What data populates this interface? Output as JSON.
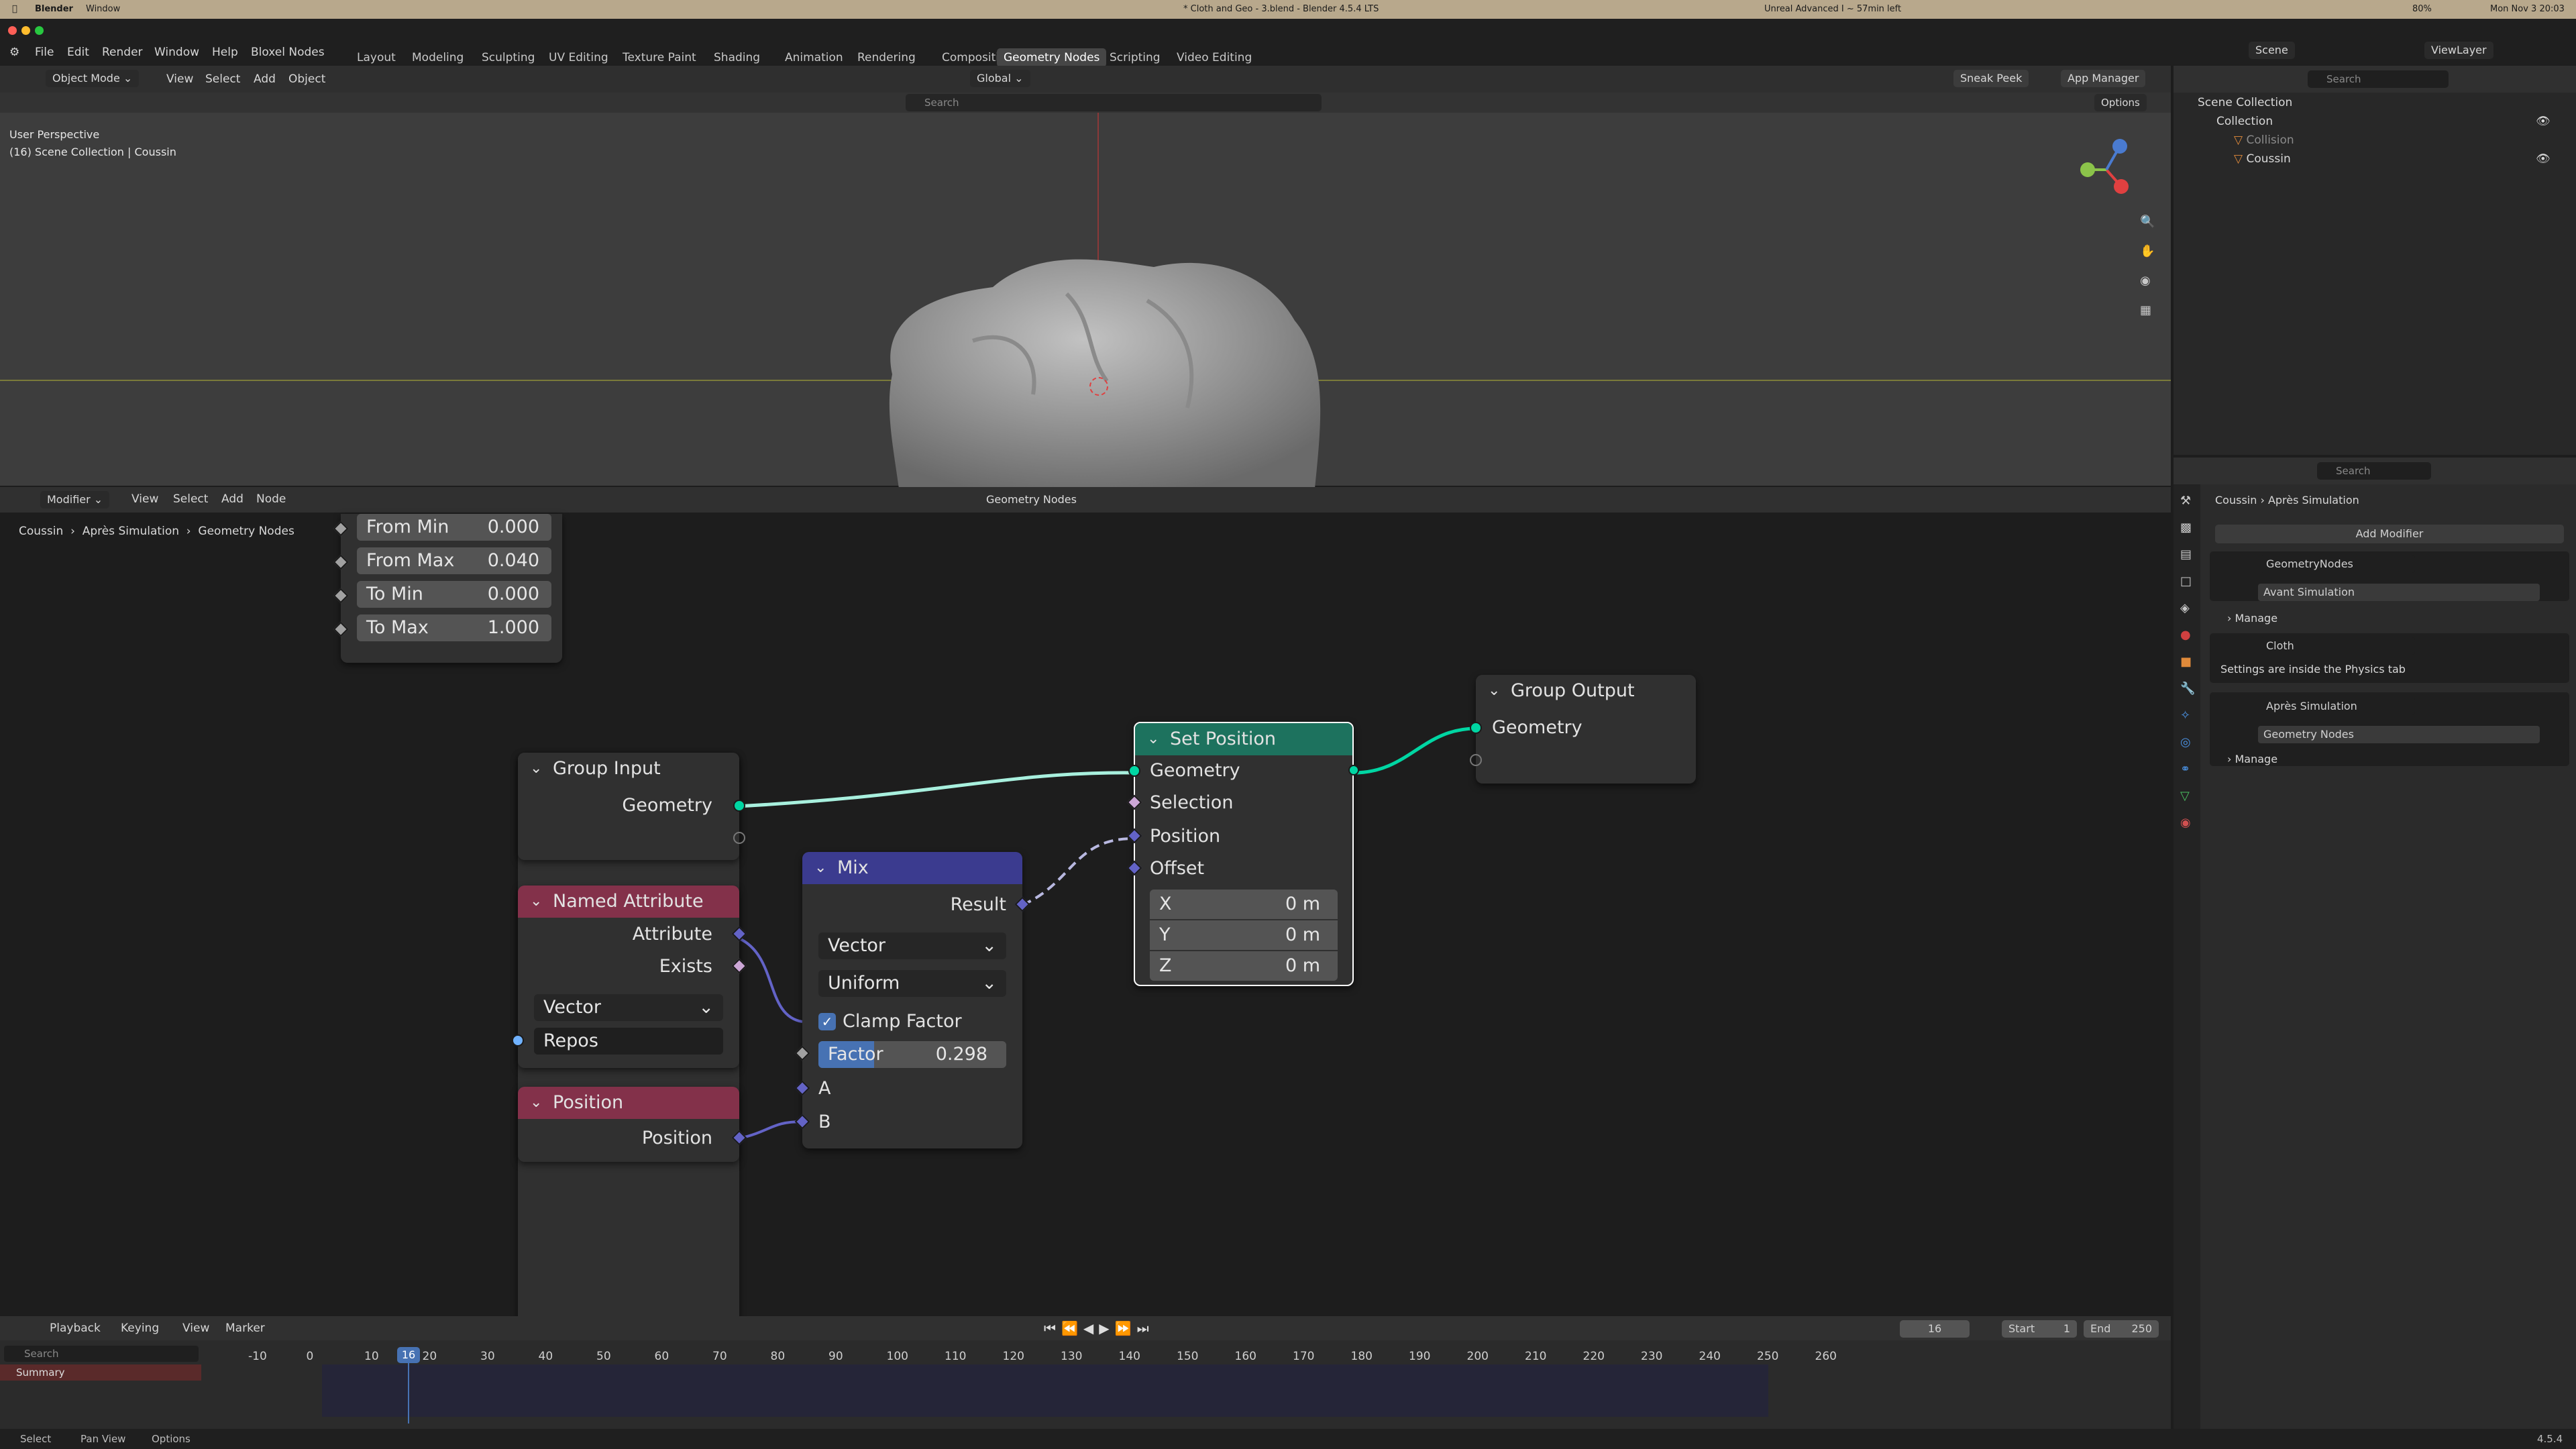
{
  "macbar": {
    "app": "Blender",
    "window": "Window",
    "doc_title": "* Cloth and Geo - 3.blend - Blender 4.5.4 LTS",
    "status": "Unreal Advanced I ~ 57min left",
    "battery": "80%",
    "datetime": "Mon Nov 3 20:03"
  },
  "menu": {
    "file": "File",
    "edit": "Edit",
    "render": "Render",
    "window": "Window",
    "help": "Help",
    "bloxel": "Bloxel Nodes"
  },
  "workspaces": [
    "Layout",
    "Modeling",
    "Sculpting",
    "UV Editing",
    "Texture Paint",
    "Shading",
    "Animation",
    "Rendering",
    "Compositing",
    "Geometry Nodes",
    "Scripting",
    "Video Editing"
  ],
  "workspace_active": "Geometry Nodes",
  "scene": "Scene",
  "viewlayer": "ViewLayer",
  "viewport": {
    "mode": "Object Mode",
    "menu_view": "View",
    "menu_select": "Select",
    "menu_add": "Add",
    "menu_object": "Object",
    "orientation": "Global",
    "sneak_peek": "Sneak Peek",
    "app_manager": "App Manager",
    "search_placeholder": "Search",
    "options": "Options",
    "overlay_line1": "User Perspective",
    "overlay_line2": "(16) Scene Collection | Coussin"
  },
  "outliner": {
    "search_placeholder": "Search",
    "scene_collection": "Scene Collection",
    "collection": "Collection",
    "items": [
      "Collision",
      "Coussin"
    ]
  },
  "node_editor": {
    "editor_type": "Modifier",
    "menu_view": "View",
    "menu_select": "Select",
    "menu_add": "Add",
    "menu_node": "Node",
    "tree_name": "Geometry Nodes",
    "breadcrumb": [
      "Coussin",
      "Après Simulation",
      "Geometry Nodes"
    ]
  },
  "nodes": {
    "map_range": {
      "from_min_label": "From Min",
      "from_min": "0.000",
      "from_max_label": "From Max",
      "from_max": "0.040",
      "to_min_label": "To Min",
      "to_min": "0.000",
      "to_max_label": "To Max",
      "to_max": "1.000"
    },
    "group_input": {
      "title": "Group Input",
      "geometry": "Geometry"
    },
    "named_attribute": {
      "title": "Named Attribute",
      "attribute": "Attribute",
      "exists": "Exists",
      "type": "Vector",
      "name": "Repos"
    },
    "position": {
      "title": "Position",
      "position": "Position"
    },
    "mix": {
      "title": "Mix",
      "result": "Result",
      "type": "Vector",
      "mode": "Uniform",
      "clamp": "Clamp Factor",
      "factor_label": "Factor",
      "factor": "0.298",
      "factor_fraction": 0.298,
      "a": "A",
      "b": "B"
    },
    "set_position": {
      "title": "Set Position",
      "geometry": "Geometry",
      "selection": "Selection",
      "position": "Position",
      "offset": "Offset",
      "x_label": "X",
      "x": "0 m",
      "y_label": "Y",
      "y": "0 m",
      "z_label": "Z",
      "z": "0 m"
    },
    "group_output": {
      "title": "Group Output",
      "geometry": "Geometry"
    }
  },
  "properties": {
    "search_placeholder": "Search",
    "breadcrumb": [
      "Coussin",
      "Après Simulation"
    ],
    "add_modifier": "Add Modifier",
    "mod1": "GeometryNodes",
    "mod1_tree": "Avant Simulation",
    "manage": "Manage",
    "mod2": "Cloth",
    "mod2_note": "Settings are inside the Physics tab",
    "mod3": "Après Simulation",
    "mod3_tree": "Geometry Nodes"
  },
  "timeline": {
    "playback": "Playback",
    "keying": "Keying",
    "view": "View",
    "marker": "Marker",
    "current_frame": "16",
    "start_label": "Start",
    "start": "1",
    "end_label": "End",
    "end": "250",
    "search_placeholder": "Search",
    "summary": "Summary",
    "ticks": [
      "-10",
      "0",
      "10",
      "20",
      "30",
      "40",
      "50",
      "60",
      "70",
      "80",
      "90",
      "100",
      "110",
      "120",
      "130",
      "140",
      "150",
      "160",
      "170",
      "180",
      "190",
      "200",
      "210",
      "220",
      "230",
      "240",
      "250",
      "260"
    ]
  },
  "status": {
    "select": "Select",
    "pan": "Pan View",
    "options": "Options",
    "version": "4.5.4"
  },
  "colors": {
    "accent": "#4772b3",
    "geometry_socket": "#00d6a3",
    "vector_socket": "#6363c7",
    "set_position_header": "#1d725e",
    "mix_header": "#3b3b8f",
    "attr_header": "#83314a",
    "playhead": "#4772b3"
  }
}
